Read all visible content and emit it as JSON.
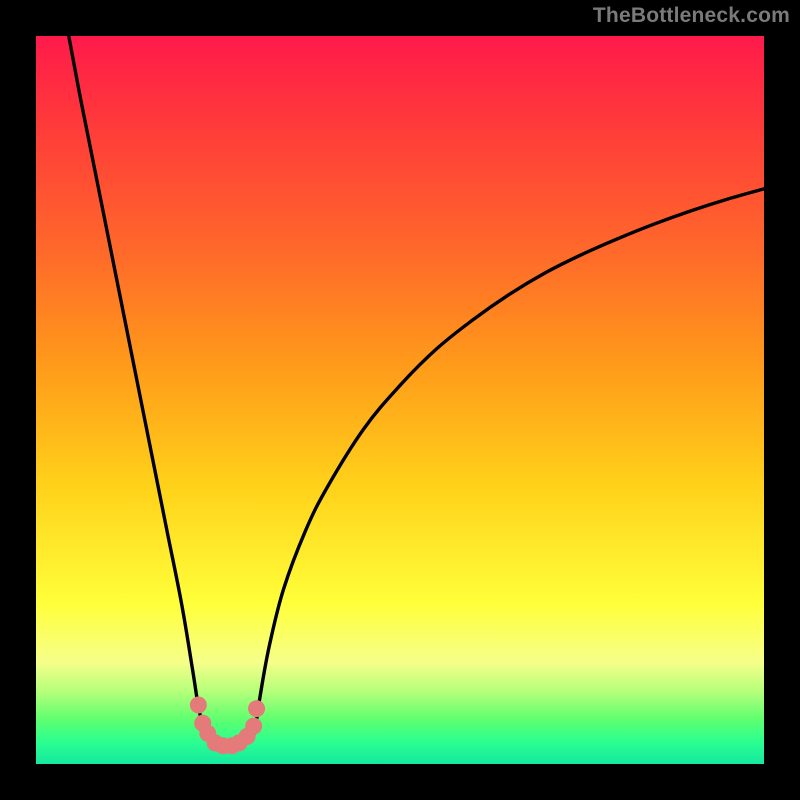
{
  "watermark": "TheBottleneck.com",
  "colors": {
    "background": "#000000",
    "gradient_top": "#ff1a4b",
    "gradient_mid1": "#ff9a1a",
    "gradient_mid2": "#ffff3a",
    "gradient_bottom": "#15e8a0",
    "curve": "#000000",
    "markers": "#e47a7a"
  },
  "chart_data": {
    "type": "line",
    "title": "",
    "xlabel": "",
    "ylabel": "",
    "xlim": [
      0,
      100
    ],
    "ylim": [
      0,
      100
    ],
    "series": [
      {
        "name": "left-branch",
        "x": [
          4.5,
          6,
          8,
          10,
          12,
          14,
          16,
          18,
          20,
          21.5,
          22.2,
          22.7,
          23.0,
          23.7,
          24.8,
          26.2,
          27.3
        ],
        "y": [
          100,
          92,
          82,
          72,
          62,
          52,
          42,
          32,
          22,
          13,
          8.5,
          6.0,
          4.8,
          3.5,
          2.7,
          2.5,
          2.6
        ]
      },
      {
        "name": "right-branch",
        "x": [
          27.3,
          28.3,
          29.3,
          30.0,
          30.3,
          30.7,
          32,
          34,
          37,
          40,
          45,
          50,
          55,
          60,
          65,
          70,
          75,
          80,
          85,
          90,
          95,
          100
        ],
        "y": [
          2.6,
          2.8,
          3.3,
          4.2,
          6.0,
          8.8,
          16,
          24,
          32,
          38,
          46,
          52,
          57,
          61,
          64.5,
          67.5,
          70,
          72.2,
          74.2,
          76,
          77.6,
          79
        ]
      }
    ],
    "markers": {
      "name": "highlighted-points",
      "x": [
        22.3,
        22.9,
        23.6,
        24.6,
        25.7,
        26.9,
        27.9,
        29.0,
        29.9,
        30.3
      ],
      "y": [
        8.1,
        5.6,
        4.2,
        2.9,
        2.5,
        2.5,
        2.9,
        3.8,
        5.2,
        7.6
      ]
    }
  }
}
